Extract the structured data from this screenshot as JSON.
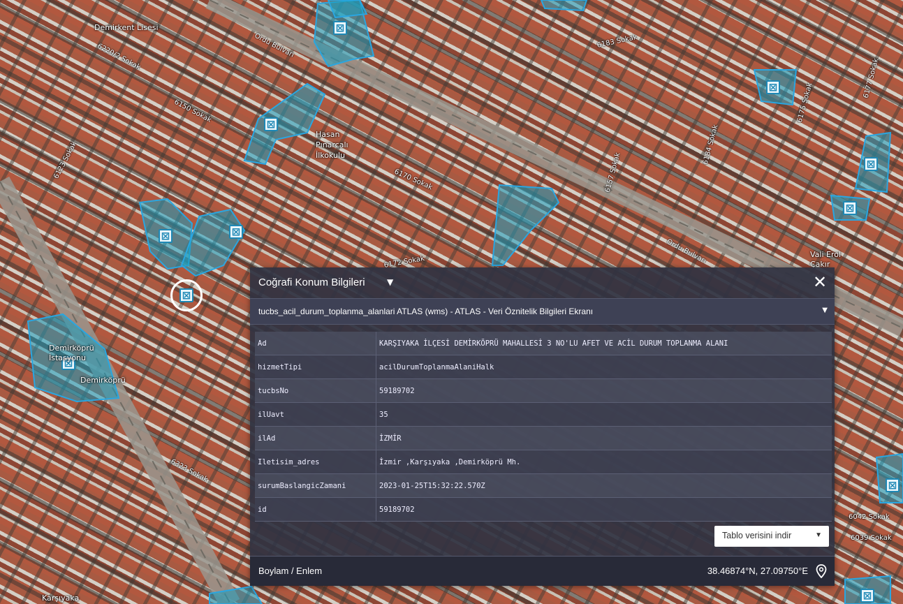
{
  "map": {
    "street_labels": [
      "Ordu Bulvarı",
      "Ordu Bulvarı",
      "6170 Sokak",
      "6172 Sokak",
      "6157 Sokak",
      "6184 Sokak",
      "6123 Sokak",
      "6150 Sokak",
      "6220/2 Sokak",
      "6183 Sokak",
      "6175 Sokak",
      "6177 Sokak",
      "6323 Sokak",
      "6042 Sokak",
      "6039 Sokak"
    ],
    "poi_labels": [
      "Demirkent Lisesi",
      "Hasan Pınarcalı İlkokulu",
      "Demirköprü İstasyonu",
      "Demirköprü",
      "Vali Erol Çakır",
      "Karşıyaka"
    ]
  },
  "panel": {
    "title": "Coğrafi Konum Bilgileri",
    "title_caret_icon": "caret-down-icon",
    "close_label": "✕",
    "layer": "tucbs_acil_durum_toplanma_alanlari ATLAS (wms) - ATLAS - Veri Öznitelik Bilgileri Ekranı",
    "attributes": [
      {
        "key": "Ad",
        "value": "KARŞIYAKA İLÇESİ DEMİRKÖPRÜ MAHALLESİ 3 NO'LU AFET VE ACİL DURUM TOPLANMA ALANI"
      },
      {
        "key": "hizmetTipi",
        "value": "acilDurumToplanmaAlaniHalk"
      },
      {
        "key": "tucbsNo",
        "value": "59189702"
      },
      {
        "key": "ilUavt",
        "value": "35"
      },
      {
        "key": "ilAd",
        "value": "İZMİR"
      },
      {
        "key": "Iletisim_adres",
        "value": "İzmir ,Karşıyaka ,Demirköprü Mh."
      },
      {
        "key": "surumBaslangicZamani",
        "value": "2023-01-25T15:32:22.570Z"
      },
      {
        "key": "id",
        "value": "59189702"
      }
    ],
    "download_label": "Tablo verisini indir",
    "coord_label": "Boylam / Enlem",
    "coord_value": "38.46874°N, 27.09750°E",
    "pin_icon": "location-pin-icon"
  },
  "colors": {
    "panel_bg": "#303342",
    "assembly_area_fill": "#1a9fc0",
    "marker_border": "#1e88b5"
  }
}
